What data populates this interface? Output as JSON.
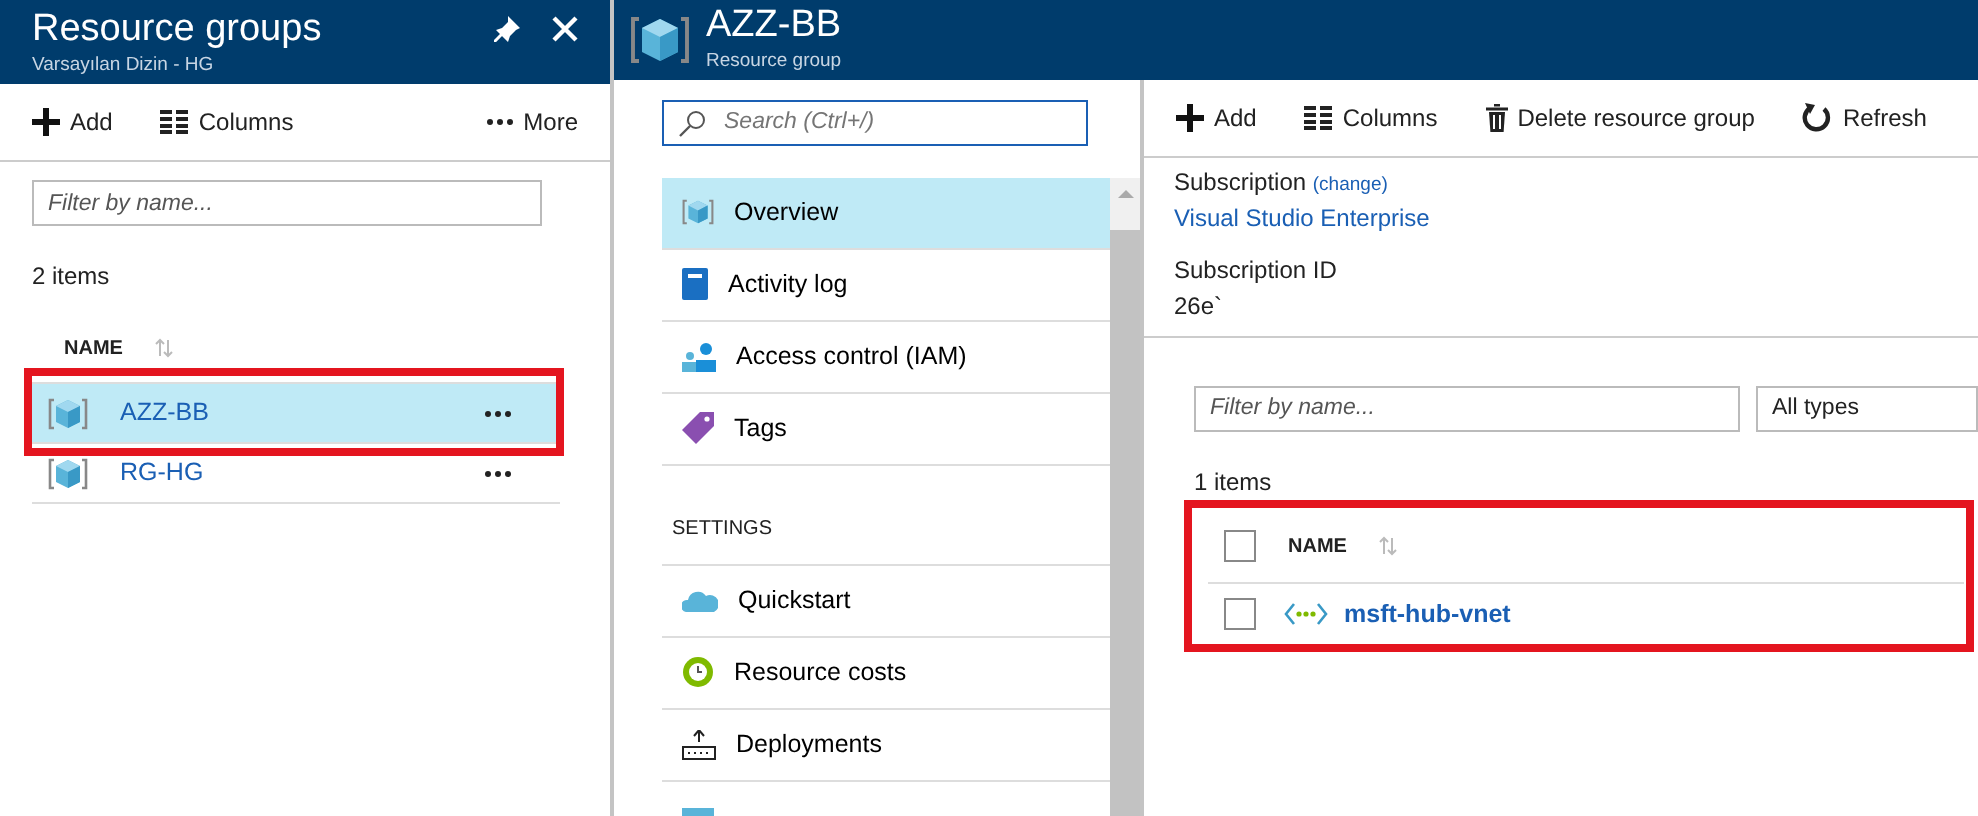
{
  "resource_groups_panel": {
    "title": "Resource groups",
    "subtitle": "Varsayılan Dizin - HG",
    "toolbar": [
      {
        "kind": "add",
        "label": "Add"
      },
      {
        "kind": "columns",
        "label": "Columns"
      },
      {
        "kind": "more",
        "label": "More"
      }
    ],
    "filter": {
      "placeholder": "Filter by name..."
    },
    "count": "2 items",
    "column": "NAME",
    "rows": [
      {
        "name": "AZZ-BB",
        "selected": true,
        "outlined": true
      },
      {
        "name": "RG-HG",
        "selected": false,
        "outlined": false
      }
    ]
  },
  "resource_group_blade": {
    "title": "AZZ-BB",
    "subtitle": "Resource group",
    "search": {
      "placeholder": "Search (Ctrl+/)"
    },
    "menu": [
      {
        "kind": "item",
        "label": "Overview",
        "selected": true
      },
      {
        "kind": "item",
        "label": "Activity log",
        "selected": false
      },
      {
        "kind": "item",
        "label": "Access control (IAM)",
        "selected": false
      },
      {
        "kind": "item",
        "label": "Tags",
        "selected": false
      },
      {
        "kind": "heading",
        "label": "SETTINGS"
      },
      {
        "kind": "item",
        "label": "Quickstart",
        "selected": false
      },
      {
        "kind": "item",
        "label": "Resource costs",
        "selected": false
      },
      {
        "kind": "item",
        "label": "Deployments",
        "selected": false
      },
      {
        "kind": "item",
        "selected": false
      }
    ],
    "toolbar": [
      {
        "kind": "add",
        "label": "Add"
      },
      {
        "kind": "columns",
        "label": "Columns"
      },
      {
        "kind": "delete",
        "label": "Delete resource group"
      },
      {
        "kind": "refresh",
        "label": "Refresh"
      }
    ],
    "essentials": {
      "subscription_label": "Subscription",
      "change_link": "(change)",
      "subscription": "Visual Studio Enterprise",
      "subscription_id_label": "Subscription ID",
      "subscription_id": "26e`"
    },
    "filter": {
      "placeholder": "Filter by name..."
    },
    "type_filter": "All types",
    "count": "1 items",
    "resources": {
      "outlined": true,
      "all_checked": false,
      "column": "NAME",
      "rows": [
        {
          "name": "msft-hub-vnet",
          "checked": false
        }
      ]
    }
  }
}
